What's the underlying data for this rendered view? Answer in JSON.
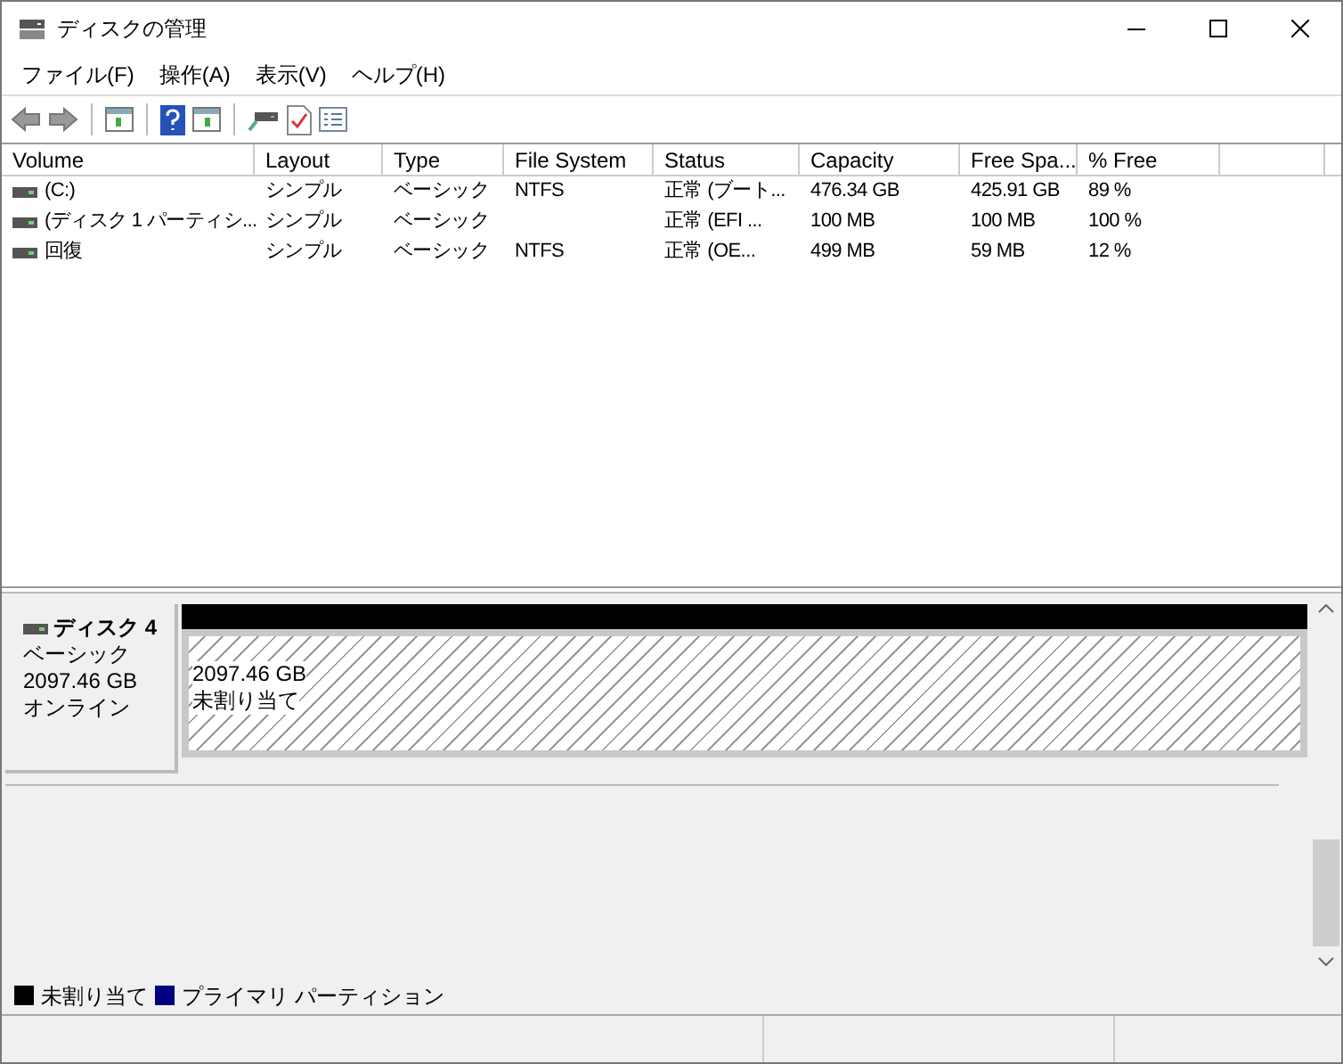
{
  "window": {
    "title": "ディスクの管理"
  },
  "menu": [
    "ファイル(F)",
    "操作(A)",
    "表示(V)",
    "ヘルプ(H)"
  ],
  "table": {
    "columns": [
      "Volume",
      "Layout",
      "Type",
      "File System",
      "Status",
      "Capacity",
      "Free Spa...",
      "% Free"
    ],
    "rows": [
      [
        "(C:)",
        "シンプル",
        "ベーシック",
        "NTFS",
        "正常 (ブート...",
        "476.34 GB",
        "425.91 GB",
        "89 %"
      ],
      [
        "(ディスク 1 パーティシ...",
        "シンプル",
        "ベーシック",
        "",
        "正常 (EFI ...",
        "100 MB",
        "100 MB",
        "100 %"
      ],
      [
        "回復",
        "シンプル",
        "ベーシック",
        "NTFS",
        "正常 (OE...",
        "499 MB",
        "59 MB",
        "12 %"
      ]
    ]
  },
  "disk": {
    "name": "ディスク 4",
    "type": "ベーシック",
    "size": "2097.46 GB",
    "status": "オンライン",
    "partitions": [
      {
        "size": "2097.46 GB",
        "label": "未割り当て",
        "color": "#000000",
        "kind": "unallocated"
      }
    ]
  },
  "legend": [
    {
      "label": "未割り当て",
      "color": "#000000"
    },
    {
      "label": "プライマリ パーティション",
      "color": "#000080"
    }
  ]
}
